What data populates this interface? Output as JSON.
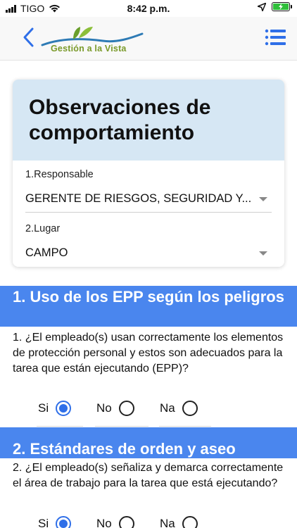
{
  "status_bar": {
    "carrier": "TIGO",
    "time": "8:42 p.m."
  },
  "header": {
    "logo_text": "Gestión a la Vista",
    "icons": {
      "back": "chevron-left-icon",
      "menu": "hamburger-menu-icon"
    },
    "accent_color": "#2f6fe8"
  },
  "form_card": {
    "title": "Observaciones de comportamiento",
    "fields": [
      {
        "label": "1.Responsable",
        "value": "GERENTE DE RIESGOS, SEGURIDAD Y..."
      },
      {
        "label": "2.Lugar",
        "value": "CAMPO"
      }
    ]
  },
  "sections": [
    {
      "title": "1. Uso de los EPP según los peligros",
      "question": "1. ¿El empleado(s) usan correctamente los elementos de protección personal y estos son adecuados para la tarea que están ejecutando (EPP)?",
      "options": [
        "Si",
        "No",
        "Na"
      ],
      "selected": "Si"
    },
    {
      "title": "2. Estándares de orden y aseo",
      "question": "2. ¿El empleado(s) señaliza y demarca correctamente el área de trabajo para la tarea que está ejecutando?",
      "options": [
        "Si",
        "No",
        "Na"
      ],
      "selected": "Si"
    }
  ],
  "colors": {
    "section_band": "#4a86ee",
    "card_header": "#d6e7f4",
    "radio_selected": "#2f6fe8"
  }
}
